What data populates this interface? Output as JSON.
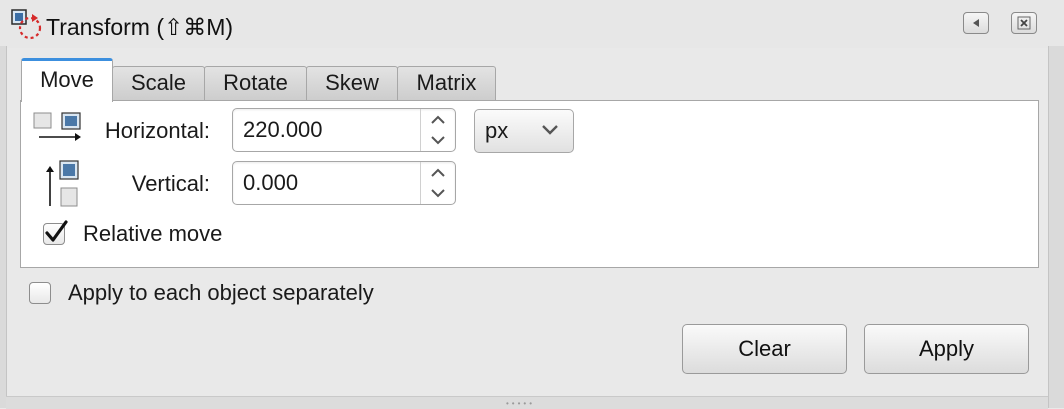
{
  "window": {
    "title": "Transform (⇧⌘M)",
    "title_icon": "transform-icon",
    "collapse_icon": "collapse-left-icon",
    "close_icon": "close-icon"
  },
  "tabs": [
    {
      "label": "Move",
      "active": true
    },
    {
      "label": "Scale",
      "active": false
    },
    {
      "label": "Rotate",
      "active": false
    },
    {
      "label": "Skew",
      "active": false
    },
    {
      "label": "Matrix",
      "active": false
    }
  ],
  "move": {
    "horizontal": {
      "label": "Horizontal:",
      "value": "220.000",
      "icon": "horizontal-move-icon"
    },
    "vertical": {
      "label": "Vertical:",
      "value": "0.000",
      "icon": "vertical-move-icon"
    },
    "unit": "px",
    "relative_move": {
      "label": "Relative move",
      "checked": true
    }
  },
  "apply_separately": {
    "label": "Apply to each object separately",
    "checked": false
  },
  "buttons": {
    "clear": "Clear",
    "apply": "Apply"
  },
  "colors": {
    "accent": "#3c8fde",
    "panel_bg": "#ffffff",
    "window_bg": "#e9e9e9"
  }
}
